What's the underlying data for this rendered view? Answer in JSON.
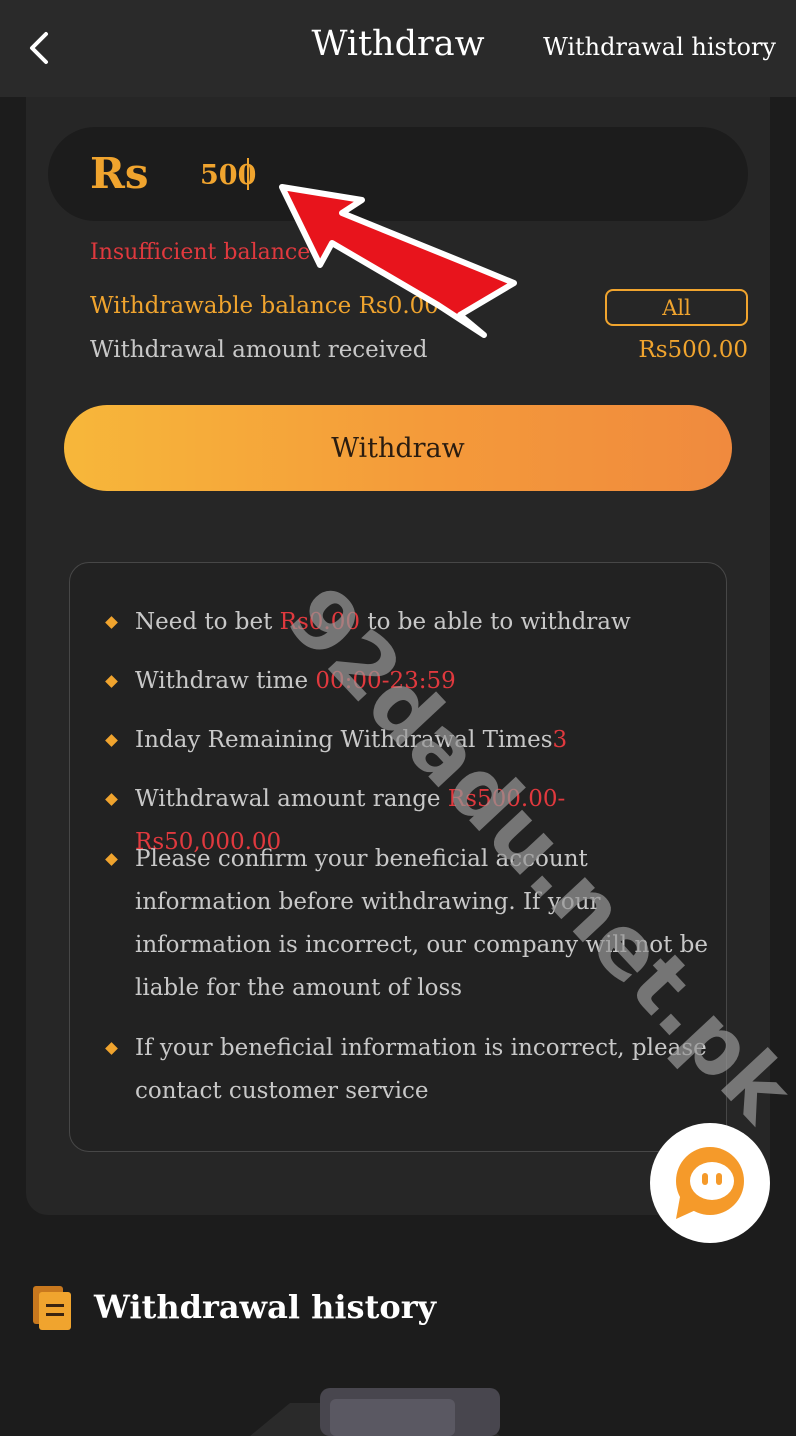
{
  "header": {
    "title": "Withdraw",
    "history_link": "Withdrawal history"
  },
  "amount": {
    "currency": "Rs",
    "value": "500"
  },
  "error_text": "Insufficient balance",
  "withdrawable": {
    "label": "Withdrawable balance Rs0.00",
    "all_button": "All"
  },
  "received": {
    "label": "Withdrawal amount received",
    "value": "Rs500.00"
  },
  "withdraw_button": "Withdraw",
  "rules": [
    {
      "text": "Need to bet ",
      "highlight": "Rs0.00",
      "after": " to be able to withdraw"
    },
    {
      "text": "Withdraw time ",
      "highlight": "00:00-23:59",
      "after": ""
    },
    {
      "text": "Inday Remaining Withdrawal Times",
      "highlight": "3",
      "after": ""
    },
    {
      "text": "Withdrawal amount range ",
      "highlight": "Rs500.00-Rs50,000.00",
      "after": ""
    },
    {
      "text": "Please confirm your beneficial account information before withdrawing. If your information is incorrect, our company will not be liable for the amount of loss",
      "highlight": "",
      "after": ""
    },
    {
      "text": "If your beneficial information is incorrect, please contact customer service",
      "highlight": "",
      "after": ""
    }
  ],
  "watermark": "92dadu.net.pk",
  "history_section": {
    "title": "Withdrawal history"
  },
  "colors": {
    "accent": "#f0a42e",
    "error": "#e0393e",
    "background": "#1c1c1c",
    "card": "#262626",
    "arrow": "#e8141c"
  },
  "icons": {
    "back": "chevron-left-icon",
    "chat": "chat-support-icon",
    "history": "document-icon",
    "empty": "empty-box-icon"
  }
}
